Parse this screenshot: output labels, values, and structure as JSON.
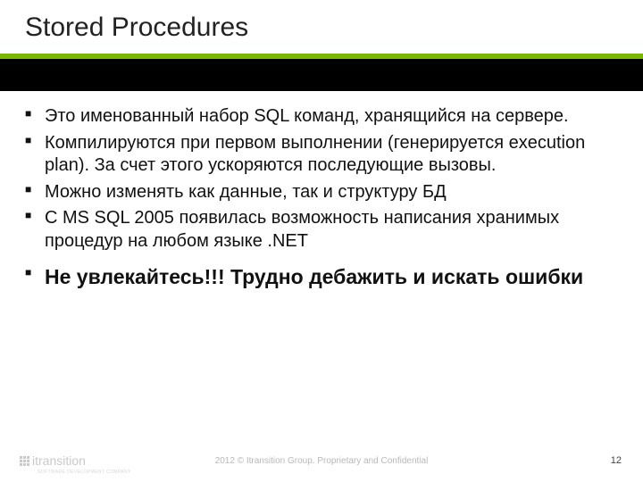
{
  "title": "Stored Procedures",
  "bullets": [
    {
      "text": "Это именованный набор SQL команд, хранящийся на сервере.",
      "bold": false
    },
    {
      "text": "Компилируются при первом выполнении (генерируется execution plan). За счет этого ускоряются последующие вызовы.",
      "bold": false
    },
    {
      "text": "Можно изменять как данные, так и структуру БД",
      "bold": false
    },
    {
      "text": "С MS SQL 2005 появилась возможность написания хранимых процедур на любом языке .NET",
      "bold": false
    },
    {
      "text": "Не увлекайтесь!!! Трудно дебажить и искать ошибки",
      "bold": true
    }
  ],
  "footer": "2012 © Itransition Group. Proprietary and Confidential",
  "page": "12",
  "logo": {
    "text": "itransition",
    "sub": "SOFTWARE DEVELOPMENT COMPANY"
  }
}
